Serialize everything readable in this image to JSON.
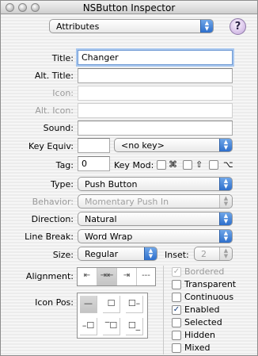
{
  "window": {
    "title": "NSButton Inspector"
  },
  "panel_selector": {
    "value": "Attributes"
  },
  "help": {
    "label": "?"
  },
  "labels": {
    "title": "Title:",
    "alt_title": "Alt. Title:",
    "icon": "Icon:",
    "alt_icon": "Alt. Icon:",
    "sound": "Sound:",
    "key_equiv": "Key Equiv:",
    "tag": "Tag:",
    "key_mod": "Key Mod:",
    "type": "Type:",
    "behavior": "Behavior:",
    "direction": "Direction:",
    "line_break": "Line Break:",
    "size": "Size:",
    "inset": "Inset:",
    "alignment": "Alignment:",
    "icon_pos": "Icon Pos:"
  },
  "fields": {
    "title": "Changer",
    "alt_title": "",
    "icon": "",
    "alt_icon": "",
    "sound": "",
    "key_equiv": "",
    "tag": "0"
  },
  "key_popup": {
    "value": "<no key>"
  },
  "modifiers": {
    "cmd": "⌘",
    "shift": "⇧",
    "option": "⌥"
  },
  "popups": {
    "type": "Push Button",
    "behavior": "Momentary Push In",
    "direction": "Natural",
    "line_break": "Word Wrap",
    "size": "Regular",
    "inset": "2"
  },
  "alignment": [
    "⇤",
    "⇥⇤",
    "⇥",
    "---"
  ],
  "icon_pos": [
    "—",
    "☐",
    "☐–",
    "–☐",
    "‾☐",
    "☐_"
  ],
  "checkboxes": [
    {
      "label": "Bordered",
      "checked": true,
      "disabled": true
    },
    {
      "label": "Transparent",
      "checked": false,
      "disabled": false
    },
    {
      "label": "Continuous",
      "checked": false,
      "disabled": false
    },
    {
      "label": "Enabled",
      "checked": true,
      "disabled": false
    },
    {
      "label": "Selected",
      "checked": false,
      "disabled": false
    },
    {
      "label": "Hidden",
      "checked": false,
      "disabled": false
    },
    {
      "label": "Mixed",
      "checked": false,
      "disabled": false
    }
  ],
  "check_mark": "✓",
  "popup_arrows": "▲▼"
}
